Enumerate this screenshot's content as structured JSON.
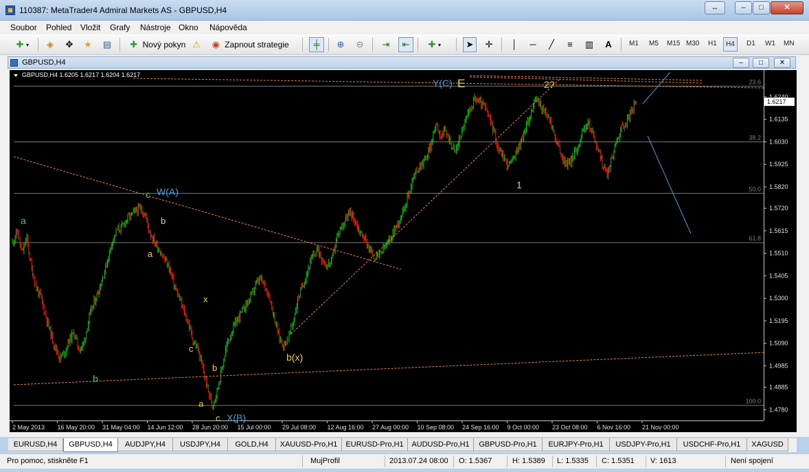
{
  "window": {
    "title": "110387: MetaTrader4 Admiral Markets AS - GBPUSD,H4",
    "btn_resize": "↔",
    "btn_min": "–",
    "btn_max": "□",
    "btn_close": "✕"
  },
  "menu": [
    "Soubor",
    "Pohled",
    "Vložit",
    "Grafy",
    "Nástroje",
    "Okno",
    "Nápověda"
  ],
  "toolbar": {
    "new_order": "Nový pokyn",
    "strategy": "Zapnout strategie",
    "timeframes": [
      "M1",
      "M5",
      "M15",
      "M30",
      "H1",
      "H4",
      "D1",
      "W1",
      "MN"
    ],
    "active_timeframe": "H4"
  },
  "child": {
    "title": "GBPUSD,H4"
  },
  "chart": {
    "header": "GBPUSD,H4  1.6205 1.6217 1.6204 1.6217",
    "price_labels": [
      "1.6240",
      "1.6135",
      "1.6030",
      "1.5925",
      "1.5820",
      "1.5720",
      "1.5615",
      "1.5510",
      "1.5405",
      "1.5300",
      "1.5195",
      "1.5090",
      "1.4985",
      "1.4885",
      "1.4780"
    ],
    "fib_labels": [
      "23.6",
      "38.2",
      "50.0",
      "61.8",
      "100.0"
    ],
    "current_price": "1.6217",
    "date_labels": [
      "2 May 2013",
      "16 May 20:00",
      "31 May 04:00",
      "14 Jun 12:00",
      "28 Jun 20:00",
      "15 Jul 00:00",
      "29 Jul 08:00",
      "12 Aug 16:00",
      "27 Aug 00:00",
      "10 Sep 08:00",
      "24 Sep 16:00",
      "9 Oct 00:00",
      "23 Oct 08:00",
      "6 Nov 16:00",
      "21 Nov 00:00"
    ],
    "wave_labels": {
      "a1": "a",
      "b1": "b",
      "c1": "c",
      "WA": "W(A)",
      "b2": "b",
      "a2": "a",
      "c2": "c",
      "x1": "x",
      "b3": "b",
      "a3": "a",
      "c3": "c",
      "XB": "X(B)",
      "bx": "b(x)",
      "YC": "Y(C)",
      "E": "E",
      "one": "1",
      "two": "2?"
    },
    "colors": {
      "bull": "#00d000",
      "bear": "#ff2000",
      "wave_green": "#46c846",
      "wave_yellow": "#f0d040",
      "wave_blue": "#3ca0e0"
    }
  },
  "chart_data": {
    "type": "candlestick",
    "symbol": "GBPUSD",
    "timeframe": "H4",
    "ohlc_last": {
      "open": 1.6205,
      "high": 1.6217,
      "low": 1.6204,
      "close": 1.6217
    },
    "ylim": [
      1.473,
      1.632
    ],
    "x_start": "2 May 2013",
    "x_end": "21 Nov 00:00",
    "close_path": [
      1.556,
      1.561,
      1.551,
      1.558,
      1.544,
      1.535,
      1.53,
      1.522,
      1.514,
      1.507,
      1.502,
      1.505,
      1.511,
      1.514,
      1.506,
      1.509,
      1.52,
      1.527,
      1.533,
      1.54,
      1.548,
      1.557,
      1.562,
      1.563,
      1.567,
      1.569,
      1.571,
      1.572,
      1.568,
      1.56,
      1.556,
      1.552,
      1.548,
      1.544,
      1.536,
      1.53,
      1.524,
      1.518,
      1.51,
      1.506,
      1.497,
      1.488,
      1.48,
      1.487,
      1.497,
      1.508,
      1.514,
      1.519,
      1.523,
      1.527,
      1.53,
      1.536,
      1.539,
      1.536,
      1.531,
      1.521,
      1.512,
      1.508,
      1.512,
      1.519,
      1.53,
      1.536,
      1.543,
      1.549,
      1.553,
      1.549,
      1.545,
      1.547,
      1.557,
      1.563,
      1.567,
      1.57,
      1.566,
      1.561,
      1.558,
      1.553,
      1.549,
      1.55,
      1.553,
      1.556,
      1.561,
      1.565,
      1.571,
      1.577,
      1.585,
      1.59,
      1.593,
      1.596,
      1.602,
      1.612,
      1.606,
      1.608,
      1.603,
      1.598,
      1.605,
      1.612,
      1.617,
      1.623,
      1.622,
      1.62,
      1.615,
      1.609,
      1.6,
      1.597,
      1.592,
      1.594,
      1.599,
      1.604,
      1.611,
      1.617,
      1.623,
      1.62,
      1.616,
      1.613,
      1.605,
      1.599,
      1.593,
      1.593,
      1.597,
      1.602,
      1.609,
      1.612,
      1.606,
      1.6,
      1.592,
      1.588,
      1.596,
      1.604,
      1.61,
      1.612,
      1.617,
      1.621
    ]
  },
  "tabs": [
    "EURUSD,H4",
    "GBPUSD,H4",
    "AUDJPY,H4",
    "USDJPY,H4",
    "GOLD,H4",
    "XAUUSD-Pro,H1",
    "EURUSD-Pro,H1",
    "AUDUSD-Pro,H1",
    "GBPUSD-Pro,H1",
    "EURJPY-Pro,H1",
    "USDJPY-Pro,H1",
    "USDCHF-Pro,H1",
    "XAGUSD"
  ],
  "status": {
    "help": "Pro pomoc, stiskněte F1",
    "profile": "MujProfil",
    "datetime": "2013.07.24 08:00",
    "open": "O: 1.5367",
    "high": "H: 1.5389",
    "low": "L: 1.5335",
    "close": "C: 1.5351",
    "volume": "V: 1613",
    "connection": "Není spojení"
  }
}
